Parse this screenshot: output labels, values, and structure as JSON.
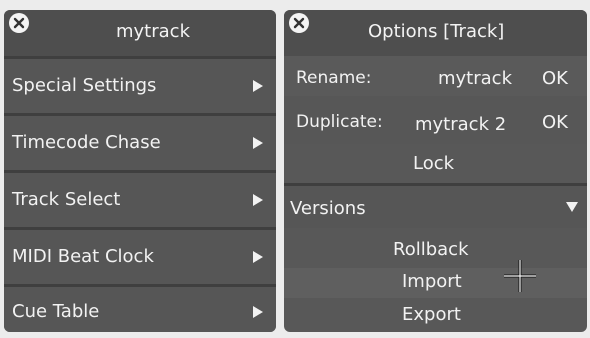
{
  "track_menu": {
    "title": "mytrack",
    "items": [
      {
        "label": "Special Settings"
      },
      {
        "label": "Timecode Chase"
      },
      {
        "label": "Track Select"
      },
      {
        "label": "MIDI Beat Clock"
      },
      {
        "label": "Cue Table"
      }
    ]
  },
  "options_panel": {
    "title": "Options [Track]",
    "rename": {
      "label": "Rename:",
      "value": "mytrack",
      "ok": "OK"
    },
    "duplicate": {
      "label": "Duplicate:",
      "value": "mytrack 2",
      "ok": "OK"
    },
    "lock_label": "Lock",
    "versions": {
      "label": "Versions",
      "items": [
        "Rollback",
        "Import",
        "Export"
      ]
    }
  },
  "colors": {
    "panel_bg": "#585858",
    "titlebar_bg": "#4e4e4e",
    "separator": "#3f3f3f",
    "text": "#f2f2f2",
    "dim_text": "#8e8e8e"
  },
  "icons": [
    "close-icon",
    "submenu-arrow-icon",
    "triangle-down-icon",
    "crosshair-cursor-icon"
  ]
}
